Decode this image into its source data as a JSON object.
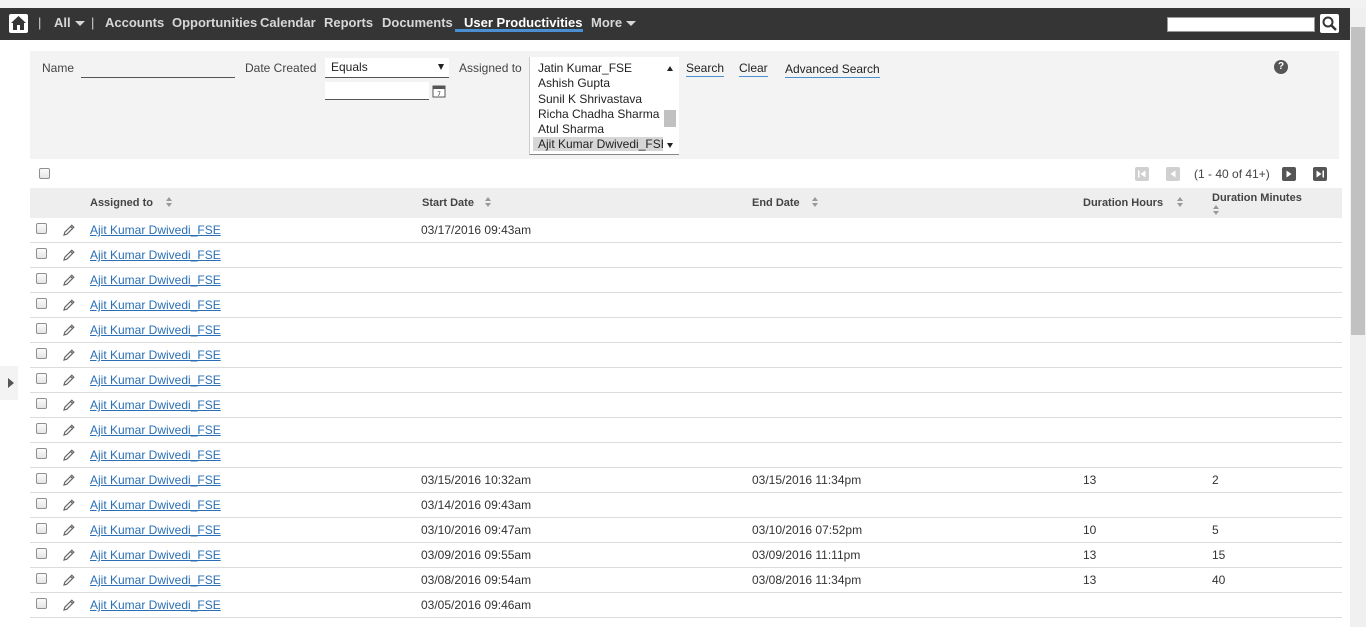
{
  "nav": {
    "sep": "|",
    "all_label": "All",
    "items": [
      "Accounts",
      "Opportunities",
      "Calendar",
      "Reports",
      "Documents",
      "User Productivities"
    ],
    "more_label": "More",
    "search_value": ""
  },
  "search": {
    "name_label": "Name",
    "name_value": "",
    "date_label": "Date Created",
    "date_operator": "Equals",
    "date_value": "",
    "assigned_label": "Assigned to",
    "assigned_options": [
      "Jatin Kumar_FSE",
      "Ashish Gupta",
      "Sunil K Shrivastava",
      "Richa Chadha Sharma",
      "Atul Sharma",
      "Ajit Kumar Dwivedi_FSE"
    ],
    "search_btn": "Search",
    "clear_btn": "Clear",
    "advanced_btn": "Advanced Search",
    "help_glyph": "?"
  },
  "pagination": {
    "range_text": "(1 - 40 of 41+)"
  },
  "table": {
    "columns": [
      "Assigned to",
      "Start Date",
      "End Date",
      "Duration Hours",
      "Duration Minutes"
    ],
    "rows": [
      {
        "assigned": "Ajit Kumar Dwivedi_FSE",
        "start": "03/17/2016 09:43am",
        "end": "",
        "hours": "",
        "minutes": ""
      },
      {
        "assigned": "Ajit Kumar Dwivedi_FSE",
        "start": "",
        "end": "",
        "hours": "",
        "minutes": ""
      },
      {
        "assigned": "Ajit Kumar Dwivedi_FSE",
        "start": "",
        "end": "",
        "hours": "",
        "minutes": ""
      },
      {
        "assigned": "Ajit Kumar Dwivedi_FSE",
        "start": "",
        "end": "",
        "hours": "",
        "minutes": ""
      },
      {
        "assigned": "Ajit Kumar Dwivedi_FSE",
        "start": "",
        "end": "",
        "hours": "",
        "minutes": ""
      },
      {
        "assigned": "Ajit Kumar Dwivedi_FSE",
        "start": "",
        "end": "",
        "hours": "",
        "minutes": ""
      },
      {
        "assigned": "Ajit Kumar Dwivedi_FSE",
        "start": "",
        "end": "",
        "hours": "",
        "minutes": ""
      },
      {
        "assigned": "Ajit Kumar Dwivedi_FSE",
        "start": "",
        "end": "",
        "hours": "",
        "minutes": ""
      },
      {
        "assigned": "Ajit Kumar Dwivedi_FSE",
        "start": "",
        "end": "",
        "hours": "",
        "minutes": ""
      },
      {
        "assigned": "Ajit Kumar Dwivedi_FSE",
        "start": "",
        "end": "",
        "hours": "",
        "minutes": ""
      },
      {
        "assigned": "Ajit Kumar Dwivedi_FSE",
        "start": "03/15/2016 10:32am",
        "end": "03/15/2016 11:34pm",
        "hours": "13",
        "minutes": "2"
      },
      {
        "assigned": "Ajit Kumar Dwivedi_FSE",
        "start": "03/14/2016 09:43am",
        "end": "",
        "hours": "",
        "minutes": ""
      },
      {
        "assigned": "Ajit Kumar Dwivedi_FSE",
        "start": "03/10/2016 09:47am",
        "end": "03/10/2016 07:52pm",
        "hours": "10",
        "minutes": "5"
      },
      {
        "assigned": "Ajit Kumar Dwivedi_FSE",
        "start": "03/09/2016 09:55am",
        "end": "03/09/2016 11:11pm",
        "hours": "13",
        "minutes": "15"
      },
      {
        "assigned": "Ajit Kumar Dwivedi_FSE",
        "start": "03/08/2016 09:54am",
        "end": "03/08/2016 11:34pm",
        "hours": "13",
        "minutes": "40"
      },
      {
        "assigned": "Ajit Kumar Dwivedi_FSE",
        "start": "03/05/2016 09:46am",
        "end": "",
        "hours": "",
        "minutes": ""
      }
    ]
  },
  "colors": {
    "navbar": "#353535",
    "accent": "#4a8fd1",
    "link": "#2a6fb5"
  }
}
